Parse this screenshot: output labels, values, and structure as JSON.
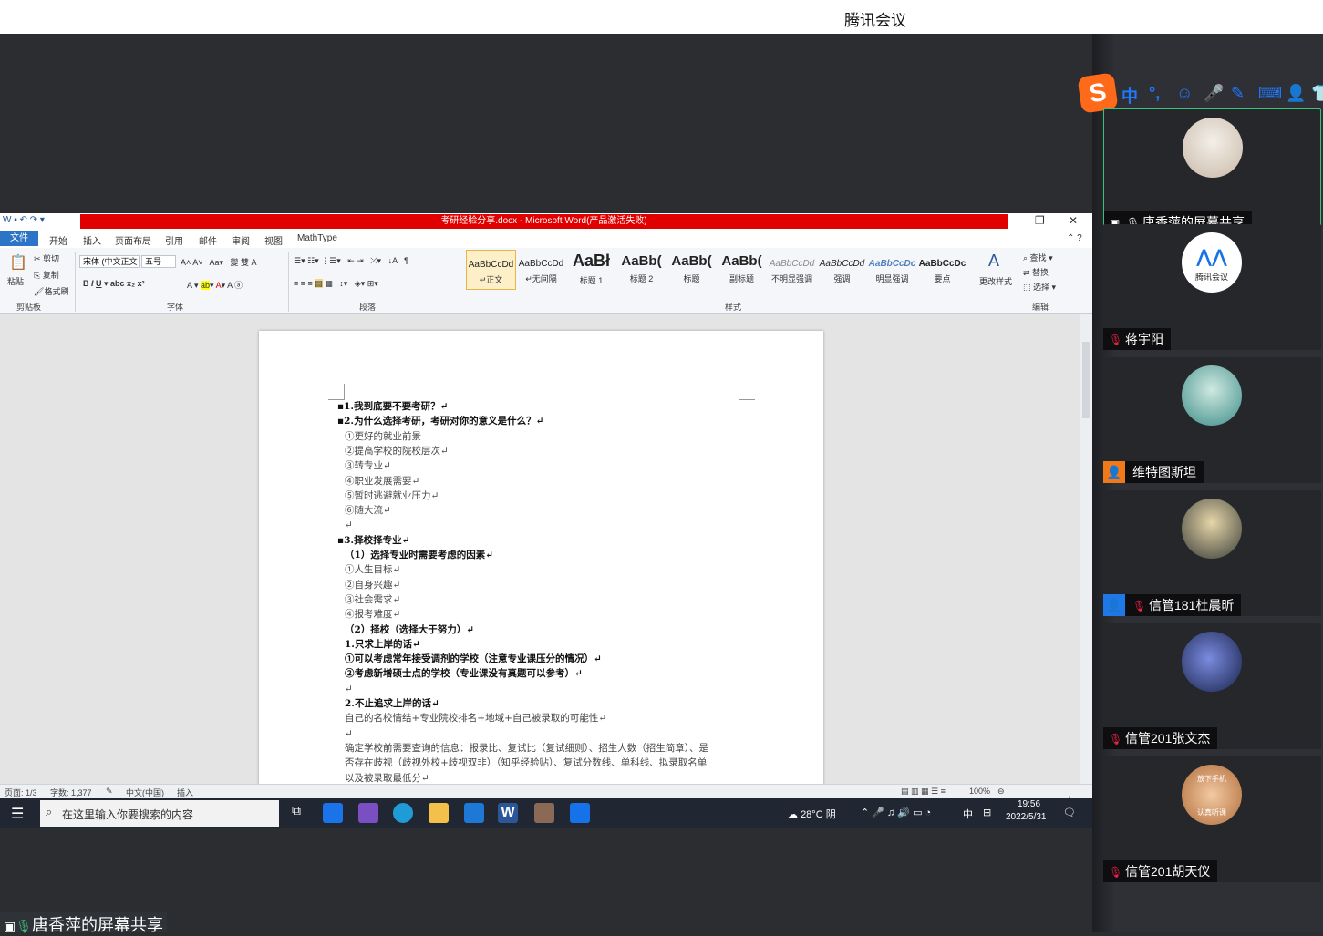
{
  "app_title": "腾讯会议",
  "word": {
    "window_title": "考研经验分享.docx - Microsoft Word(产品激活失败)",
    "tabs": [
      "文件",
      "开始",
      "插入",
      "页面布局",
      "引用",
      "邮件",
      "审阅",
      "视图",
      "MathType"
    ],
    "clipboard": {
      "paste": "粘贴",
      "cut": "剪切",
      "copy": "复制",
      "format_painter": "格式刷",
      "group": "剪贴板"
    },
    "font": {
      "name": "宋体 (中文正文",
      "size": "五号",
      "group": "字体"
    },
    "paragraph_group": "段落",
    "styles": [
      {
        "sample": "AaBbCcDd",
        "name": "↵正文"
      },
      {
        "sample": "AaBbCcDd",
        "name": "↵无间隔"
      },
      {
        "sample": "AaBł",
        "name": "标题 1"
      },
      {
        "sample": "AaBb(",
        "name": "标题 2"
      },
      {
        "sample": "AaBb(",
        "name": "标题"
      },
      {
        "sample": "AaBb(",
        "name": "副标题"
      },
      {
        "sample": "AaBbCcDd",
        "name": "不明显强调"
      },
      {
        "sample": "AaBbCcDd",
        "name": "强调"
      },
      {
        "sample": "AaBbCcDc",
        "name": "明显强调"
      },
      {
        "sample": "AaBbCcDc",
        "name": "要点"
      }
    ],
    "change_styles": "更改样式",
    "styles_group": "样式",
    "editing": {
      "find": "查找",
      "replace": "替换",
      "select": "选择",
      "group": "编辑"
    },
    "document_lines": [
      {
        "text": "▪1.我到底要不要考研？↵",
        "bold": true
      },
      {
        "text": "▪2.为什么选择考研，考研对你的意义是什么？↵",
        "bold": true
      },
      {
        "text": "①更好的就业前景",
        "bold": false
      },
      {
        "text": "②提高学校的院校层次↵",
        "bold": false
      },
      {
        "text": "③转专业↵",
        "bold": false
      },
      {
        "text": "④职业发展需要↵",
        "bold": false
      },
      {
        "text": "⑤暂时逃避就业压力↵",
        "bold": false
      },
      {
        "text": "⑥随大流↵",
        "bold": false
      },
      {
        "text": "↵",
        "bold": false
      },
      {
        "text": "▪3.择校择专业↵",
        "bold": true
      },
      {
        "text": "（1）选择专业时需要考虑的因素↵",
        "bold": true
      },
      {
        "text": "①人生目标↵",
        "bold": false
      },
      {
        "text": "②自身兴趣↵",
        "bold": false
      },
      {
        "text": "③社会需求↵",
        "bold": false
      },
      {
        "text": "④报考难度↵",
        "bold": false
      },
      {
        "text": "（2）择校（选择大于努力）↵",
        "bold": true
      },
      {
        "text": "1.只求上岸的话↵",
        "bold": true
      },
      {
        "text": "①可以考虑常年接受调剂的学校（注意专业课压分的情况）↵",
        "bold": true
      },
      {
        "text": "②考虑新增硕士点的学校（专业课没有真题可以参考）↵",
        "bold": true
      },
      {
        "text": "↵",
        "bold": false
      },
      {
        "text": "2.不止追求上岸的话↵",
        "bold": true
      },
      {
        "text": "自己的名校情结+专业院校排名+地域+自己被录取的可能性↵",
        "bold": false
      },
      {
        "text": "↵",
        "bold": false
      },
      {
        "text": "确定学校前需要查询的信息：报录比、复试比（复试细则）、招生人数（招生简章）、是",
        "bold": false
      },
      {
        "text": "否存在歧视（歧视外校+歧视双非）（知乎经验贴）、复试分数线、单科线、拟录取名单",
        "bold": false
      },
      {
        "text": "以及被录取最低分↵",
        "bold": false
      }
    ],
    "status": {
      "page": "页面: 1/3",
      "words": "字数: 1,377",
      "lang": "中文(中国)",
      "mode": "插入",
      "zoom": "100%"
    }
  },
  "taskbar": {
    "search_placeholder": "在这里输入你要搜索的内容",
    "weather": "28°C 阴",
    "ime": "中",
    "time": "19:56",
    "date": "2022/5/31"
  },
  "share_label": "唐香萍的屏幕共享",
  "participants": [
    {
      "name": "唐香萍的屏幕共享",
      "mic": "on",
      "badge": "screen-share"
    },
    {
      "name": "蒋宇阳",
      "mic": "muted",
      "badge": ""
    },
    {
      "name": "维特图斯坦",
      "mic": "none",
      "badge": "user"
    },
    {
      "name": "信管181杜晨昕",
      "mic": "muted",
      "badge": "user"
    },
    {
      "name": "信管201张文杰",
      "mic": "muted",
      "badge": ""
    },
    {
      "name": "信管201胡天仪",
      "mic": "muted",
      "badge": ""
    }
  ],
  "tencent_logo_text": "腾讯会议",
  "avatar_text": {
    "top": "放下手机",
    "bottom": "认真听课"
  },
  "ime_bar": {
    "logo": "S",
    "mode": "中"
  }
}
